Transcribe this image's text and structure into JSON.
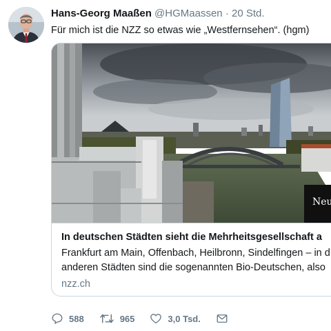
{
  "tweet": {
    "author_name": "Hans-Georg Maaßen",
    "handle": "@HGMaassen",
    "separator": "·",
    "time": "20 Std.",
    "text": "Für mich ist die NZZ so etwas wie „Westfernsehen“. (hgm)"
  },
  "card": {
    "title": "In deutschen Städten sieht die Mehrheitsgesellschaft a",
    "description_line1": "Frankfurt am Main, Offenbach, Heilbronn, Sindelfingen – in d",
    "description_line2": "anderen Städten sind die sogenannten Bio-Deutschen, also",
    "domain": "nzz.ch",
    "watermark": "Neue"
  },
  "actions": {
    "reply": {
      "icon": "reply-icon",
      "count": "588"
    },
    "retweet": {
      "icon": "retweet-icon",
      "count": "965"
    },
    "like": {
      "icon": "heart-icon",
      "count": "3,0 Tsd."
    },
    "share": {
      "icon": "mail-icon"
    }
  },
  "colors": {
    "text": "#14171a",
    "muted": "#657786",
    "border": "#ccd6dd",
    "background": "#ffffff"
  }
}
